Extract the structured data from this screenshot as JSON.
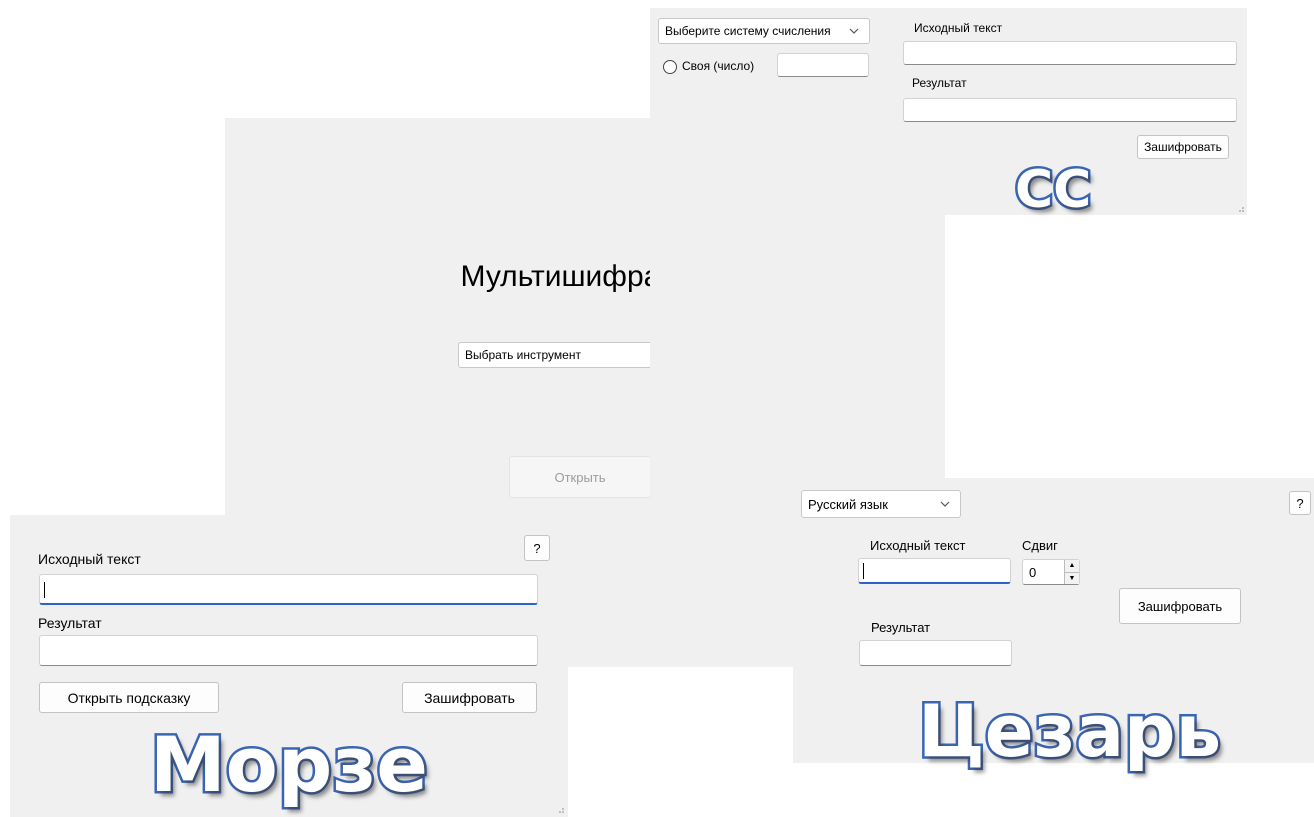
{
  "main_window": {
    "title": "Мультишифратор",
    "tool_select": "Выбрать инструмент",
    "open_button": "Открыть"
  },
  "cc_window": {
    "system_select": "Выберите систему счисления",
    "custom_radio_label": "Своя (число)",
    "custom_value": "",
    "source_label": "Исходный текст",
    "source_value": "",
    "result_label": "Результат",
    "result_value": "",
    "encrypt_button": "Зашифровать",
    "caption": "СС"
  },
  "morse_window": {
    "help_button": "?",
    "source_label": "Исходный текст",
    "source_value": "",
    "result_label": "Результат",
    "result_value": "",
    "hint_button": "Открыть подсказку",
    "encrypt_button": "Зашифровать",
    "caption": "Морзе"
  },
  "caesar_window": {
    "language_select": "Русский язык",
    "help_button": "?",
    "source_label": "Исходный текст",
    "source_value": "",
    "shift_label": "Сдвиг",
    "shift_value": "0",
    "encrypt_button": "Зашифровать",
    "result_label": "Результат",
    "result_value": "",
    "caption": "Цезарь"
  },
  "colors": {
    "window_bg": "#f0f0f0",
    "caption_outline": "#3a64b4",
    "focus_underline": "#2a64c8"
  }
}
